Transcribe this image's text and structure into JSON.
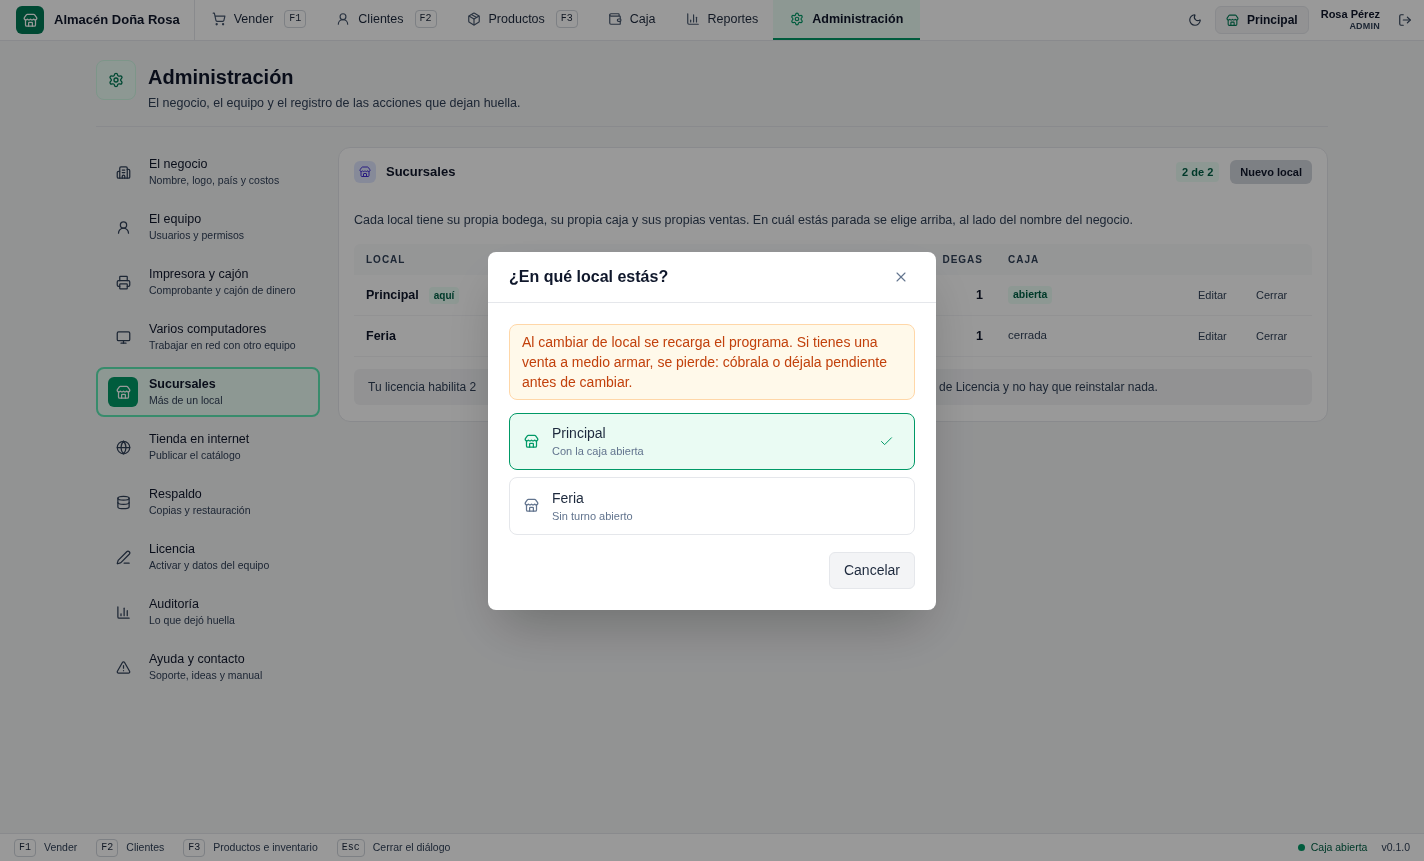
{
  "app": {
    "name": "Almacén Doña Rosa"
  },
  "nav_tabs": [
    {
      "label": "Vender",
      "shortcut": "F1",
      "selected": false
    },
    {
      "label": "Clientes",
      "shortcut": "F2",
      "selected": false
    },
    {
      "label": "Productos",
      "shortcut": "F3",
      "selected": false
    },
    {
      "label": "Caja",
      "selected": false
    },
    {
      "label": "Reportes",
      "selected": false
    },
    {
      "label": "Administración",
      "selected": true
    }
  ],
  "header_right": {
    "branch": "Principal",
    "user_name": "Rosa Pérez",
    "user_role": "ADMIN"
  },
  "page_header": {
    "title": "Administración",
    "subtitle": "El negocio, el equipo y el registro de las acciones que dejan huella."
  },
  "sidebar": {
    "items": [
      {
        "title": "El negocio",
        "subtitle": "Nombre, logo, país y costos",
        "selected": false
      },
      {
        "title": "El equipo",
        "subtitle": "Usuarios y permisos",
        "selected": false
      },
      {
        "title": "Impresora y cajón",
        "subtitle": "Comprobante y cajón de dinero",
        "selected": false
      },
      {
        "title": "Varios computadores",
        "subtitle": "Trabajar en red con otro equipo",
        "selected": false
      },
      {
        "title": "Sucursales",
        "subtitle": "Más de un local",
        "selected": true
      },
      {
        "title": "Tienda en internet",
        "subtitle": "Publicar el catálogo",
        "selected": false
      },
      {
        "title": "Respaldo",
        "subtitle": "Copias y restauración",
        "selected": false
      },
      {
        "title": "Licencia",
        "subtitle": "Activar y datos del equipo",
        "selected": false
      },
      {
        "title": "Auditoría",
        "subtitle": "Lo que dejó huella",
        "selected": false
      },
      {
        "title": "Ayuda y contacto",
        "subtitle": "Soporte, ideas y manual",
        "selected": false
      }
    ]
  },
  "panel": {
    "title": "Sucursales",
    "count": "2 de 2",
    "new_button": {
      "label": "Nuevo local",
      "disabled": true
    },
    "description": "Cada local tiene su propia bodega, su propia caja y sus propias ventas. En cuál estás parada se elige arriba, al lado del nombre del negocio.",
    "table": {
      "columns": [
        "LOCAL",
        "DEGAS",
        "CAJA"
      ],
      "rows": [
        {
          "name": "Principal",
          "tag": "aquí",
          "bodegas": "1",
          "caja": "abierta",
          "caja_open": true,
          "actions": [
            "Editar",
            "Cerrar"
          ]
        },
        {
          "name": "Feria",
          "bodegas": "1",
          "caja": "cerrada",
          "caja_open": false,
          "actions": [
            "Editar",
            "Cerrar"
          ]
        }
      ]
    },
    "note": {
      "left": "Tu licencia habilita 2",
      "right": "de Licencia y no hay que reinstalar nada."
    }
  },
  "dialog": {
    "title": "¿En qué local estás?",
    "warning": "Al cambiar de local se recarga el programa. Si tienes una venta a medio armar, se pierde: cóbrala o déjala pendiente antes de cambiar.",
    "options": [
      {
        "name": "Principal",
        "detail": "Con la caja abierta",
        "selected": true
      },
      {
        "name": "Feria",
        "detail": "Sin turno abierto",
        "selected": false
      }
    ],
    "cancel": "Cancelar"
  },
  "status_bar": {
    "shortcuts": [
      {
        "key": "F1",
        "label": "Vender"
      },
      {
        "key": "F2",
        "label": "Clientes"
      },
      {
        "key": "F3",
        "label": "Productos e inventario"
      },
      {
        "key": "Esc",
        "label": "Cerrar el diálogo"
      }
    ],
    "register": {
      "label": "Caja abierta",
      "open": true
    },
    "version": "v0.1.0"
  }
}
